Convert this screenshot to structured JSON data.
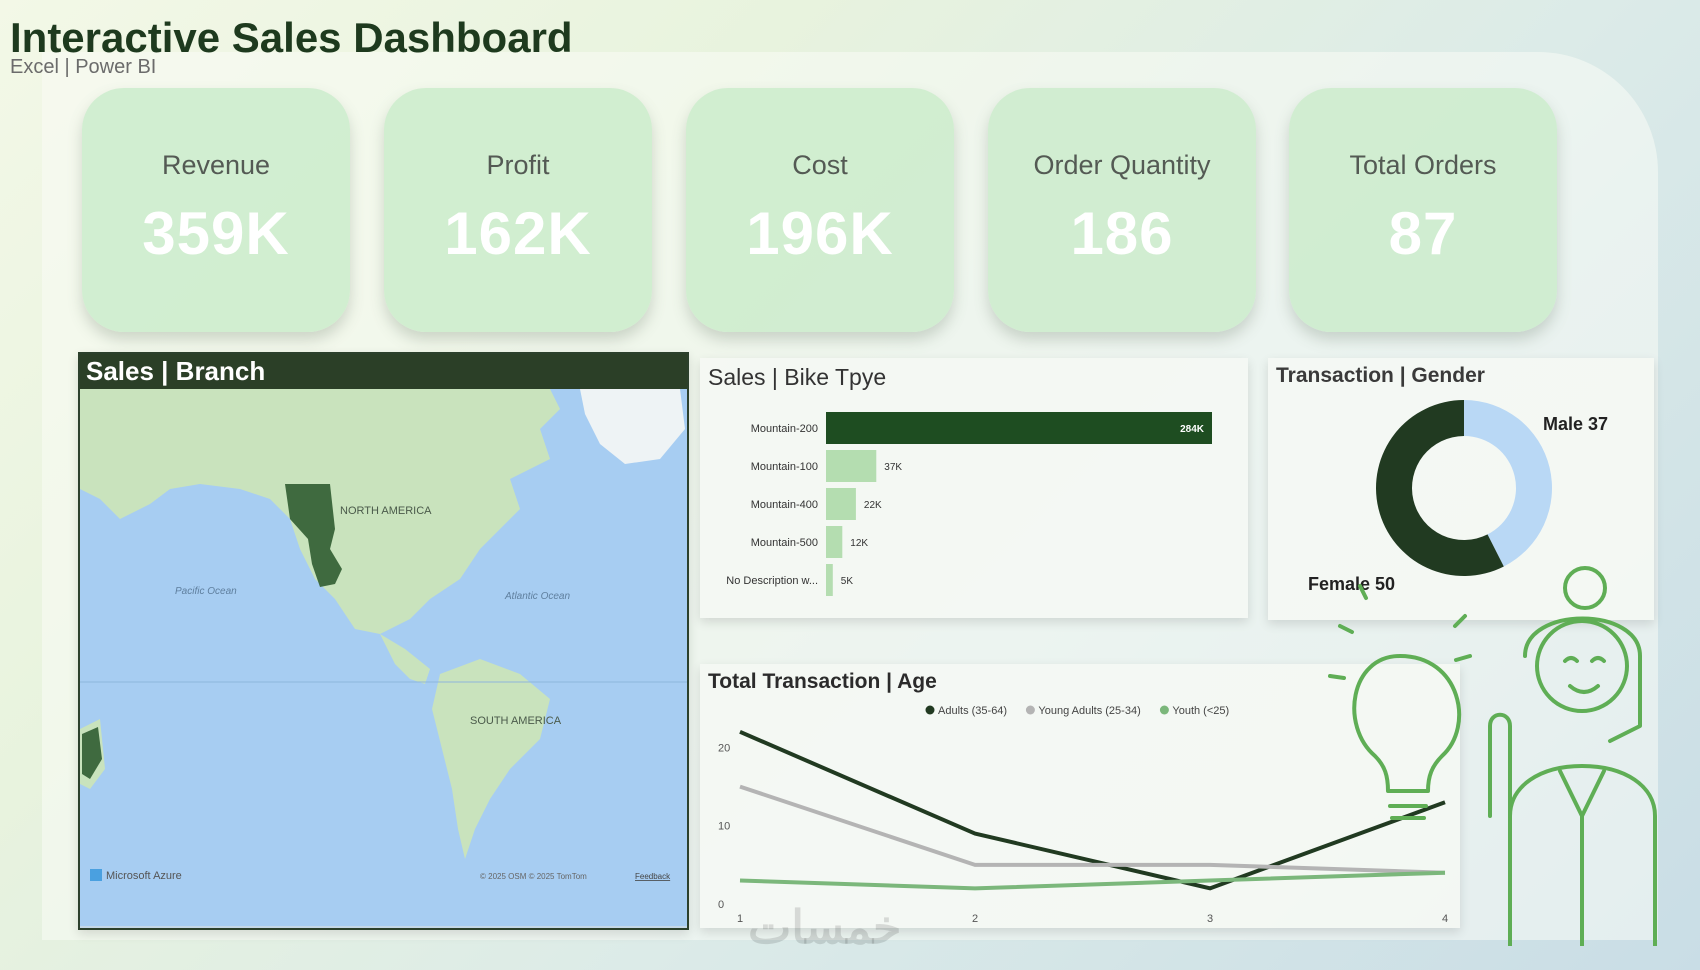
{
  "header": {
    "title": "Interactive Sales Dashboard",
    "subtitle": "Excel | Power BI"
  },
  "kpis": [
    {
      "label": "Revenue",
      "value": "359K"
    },
    {
      "label": "Profit",
      "value": "162K"
    },
    {
      "label": "Cost",
      "value": "196K"
    },
    {
      "label": "Order Quantity",
      "value": "186"
    },
    {
      "label": "Total Orders",
      "value": "87"
    }
  ],
  "map": {
    "title": "Sales | Branch",
    "labels": {
      "north_america": "NORTH AMERICA",
      "south_america": "SOUTH AMERICA",
      "pacific": "Pacific Ocean",
      "atlantic": "Atlantic Ocean"
    },
    "attribution_left": "Microsoft Azure",
    "attribution_right": "© 2025 OSM © 2025 TomTom",
    "feedback": "Feedback"
  },
  "watermark": "خمسات",
  "colors": {
    "dark_green": "#1e4d21",
    "light_green": "#b4ddb0",
    "male_blue": "#b9d8f5",
    "female_dark": "#213a21",
    "youth_green": "#7bb77b",
    "young_gray": "#b4b4b4"
  },
  "chart_data": [
    {
      "type": "bar",
      "orientation": "horizontal",
      "title": "Sales | Bike Tpye",
      "categories": [
        "Mountain-200",
        "Mountain-100",
        "Mountain-400",
        "Mountain-500",
        "No Description w..."
      ],
      "values": [
        284000,
        37000,
        22000,
        12000,
        5000
      ],
      "data_labels": [
        "284K",
        "37K",
        "22K",
        "12K",
        "5K"
      ]
    },
    {
      "type": "pie",
      "subtype": "donut",
      "title": "Transaction | Gender",
      "categories": [
        "Male",
        "Female"
      ],
      "values": [
        37,
        50
      ],
      "data_labels": [
        "Male 37",
        "Female 50"
      ]
    },
    {
      "type": "line",
      "title": "Total Transaction | Age",
      "x": [
        1,
        2,
        3,
        4
      ],
      "xticks": [
        "1",
        "2",
        "3",
        "4"
      ],
      "yticks": [
        "0",
        "10",
        "20"
      ],
      "ylim": [
        0,
        23
      ],
      "legend_position": "top",
      "series": [
        {
          "name": "Adults (35-64)",
          "values": [
            22,
            9,
            2,
            13
          ]
        },
        {
          "name": "Young Adults (25-34)",
          "values": [
            15,
            5,
            5,
            4
          ]
        },
        {
          "name": "Youth (<25)",
          "values": [
            3,
            2,
            3,
            4
          ]
        }
      ]
    }
  ]
}
